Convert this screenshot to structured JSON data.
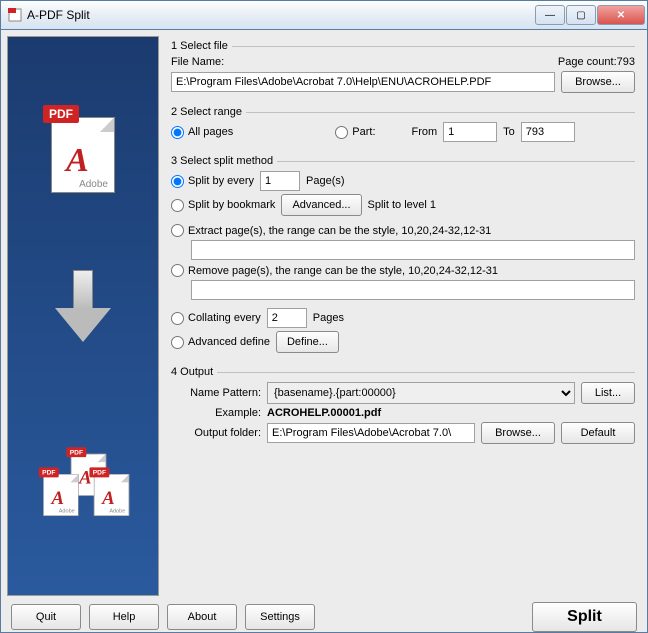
{
  "window": {
    "title": "A-PDF Split"
  },
  "winbtns": {
    "min": "—",
    "max": "▢",
    "close": "✕"
  },
  "section1": {
    "legend": "1 Select file",
    "file_label": "File Name:",
    "page_count_label": "Page count:",
    "page_count": "793",
    "path": "E:\\Program Files\\Adobe\\Acrobat 7.0\\Help\\ENU\\ACROHELP.PDF",
    "browse": "Browse..."
  },
  "section2": {
    "legend": "2 Select range",
    "all_label": "All pages",
    "part_label": "Part:",
    "from_label": "From",
    "to_label": "To",
    "from": "1",
    "to": "793"
  },
  "section3": {
    "legend": "3 Select split method",
    "split_every_label": "Split by every",
    "split_every_val": "1",
    "pages_lbl": "Page(s)",
    "bookmark_label": "Split by bookmark",
    "advanced_btn": "Advanced...",
    "split_level_text": "Split to level 1",
    "extract_label": "Extract page(s), the range can be the style, 10,20,24-32,12-31",
    "extract_val": "",
    "remove_label": "Remove page(s), the range can be the style, 10,20,24-32,12-31",
    "remove_val": "",
    "collating_label": "Collating every",
    "collating_val": "2",
    "collating_pages": "Pages",
    "adv_define_label": "Advanced define",
    "define_btn": "Define..."
  },
  "section4": {
    "legend": "4 Output",
    "name_pattern_label": "Name Pattern:",
    "name_pattern": "{basename}.{part:00000}",
    "list_btn": "List...",
    "example_label": "Example:",
    "example": "ACROHELP.00001.pdf",
    "output_folder_label": "Output folder:",
    "output_folder": "E:\\Program Files\\Adobe\\Acrobat 7.0\\",
    "browse_btn": "Browse...",
    "default_btn": "Default"
  },
  "footer": {
    "quit": "Quit",
    "help": "Help",
    "about": "About",
    "settings": "Settings",
    "split": "Split"
  },
  "icons": {
    "pdf_badge": "PDF",
    "a": "A",
    "adobe": "Adobe"
  }
}
